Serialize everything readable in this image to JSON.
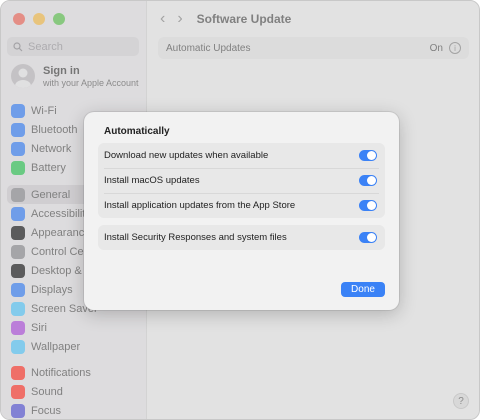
{
  "search": {
    "placeholder": "Search"
  },
  "account": {
    "name": "Sign in",
    "subtitle": "with your Apple Account"
  },
  "sidebar": {
    "group1": [
      {
        "label": "Wi-Fi",
        "icon": "wifi-icon",
        "color": "#3b82f6"
      },
      {
        "label": "Bluetooth",
        "icon": "bluetooth-icon",
        "color": "#3b82f6"
      },
      {
        "label": "Network",
        "icon": "network-icon",
        "color": "#3b82f6"
      },
      {
        "label": "Battery",
        "icon": "battery-icon",
        "color": "#34c759"
      }
    ],
    "group2": [
      {
        "label": "General",
        "icon": "gear-icon",
        "color": "#8e8e93",
        "selected": true
      },
      {
        "label": "Accessibility",
        "icon": "accessibility-icon",
        "color": "#3b82f6"
      },
      {
        "label": "Appearance",
        "icon": "appearance-icon",
        "color": "#1c1c1e"
      },
      {
        "label": "Control Centre",
        "icon": "control-centre-icon",
        "color": "#8e8e93"
      },
      {
        "label": "Desktop & Dock",
        "icon": "dock-icon",
        "color": "#1c1c1e"
      },
      {
        "label": "Displays",
        "icon": "displays-icon",
        "color": "#3b82f6"
      },
      {
        "label": "Screen Saver",
        "icon": "screen-saver-icon",
        "color": "#5ac8fa"
      },
      {
        "label": "Siri",
        "icon": "siri-icon",
        "color": "#af52de"
      },
      {
        "label": "Wallpaper",
        "icon": "wallpaper-icon",
        "color": "#5ac8fa"
      }
    ],
    "group3": [
      {
        "label": "Notifications",
        "icon": "notifications-icon",
        "color": "#ff3b30"
      },
      {
        "label": "Sound",
        "icon": "sound-icon",
        "color": "#ff3b30"
      },
      {
        "label": "Focus",
        "icon": "focus-icon",
        "color": "#5856d6"
      }
    ]
  },
  "toolbar": {
    "back": "‹",
    "forward": "›",
    "title": "Software Update"
  },
  "automatic_updates": {
    "label": "Automatic Updates",
    "value": "On",
    "info": "i"
  },
  "dialog": {
    "title": "Automatically",
    "rows_group1": [
      {
        "label": "Download new updates when available",
        "on": true
      },
      {
        "label": "Install macOS updates",
        "on": true
      },
      {
        "label": "Install application updates from the App Store",
        "on": true
      }
    ],
    "rows_group2": [
      {
        "label": "Install Security Responses and system files",
        "on": true
      }
    ],
    "done_label": "Done"
  },
  "help": "?",
  "colors": {
    "accent": "#3a82f6"
  }
}
